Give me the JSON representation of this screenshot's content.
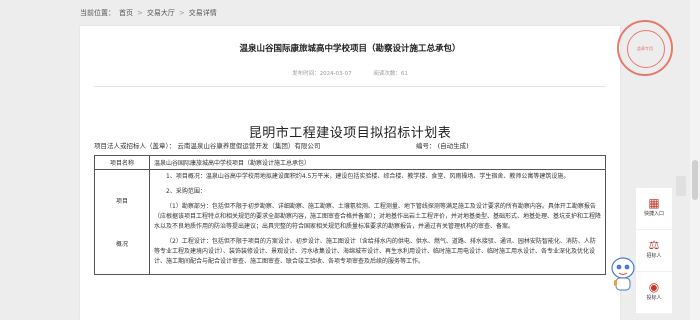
{
  "breadcrumb": {
    "current_label": "当前位置：",
    "home": "首页",
    "market": "交易大厅",
    "detail": "交易详情"
  },
  "header": {
    "title": "温泉山谷国际康旅城高中学校项目（勘察设计施工总承包）",
    "publish_label": "发布时间：2024-03-07",
    "views_label": "阅读次数：61"
  },
  "document": {
    "title": "昆明市工程建设项目拟招标计划表",
    "legal_label": "项目法人或招标人（盖章）：",
    "legal_value": "云南温泉山谷康养度假运营开发（集团）有限公司",
    "serial_label": "编号：",
    "serial_value": "(自动生成)",
    "row_name_label": "项目名称",
    "row_name_value": "温泉山谷国际康旅城高中学校项目（勘察设计施工总承包）",
    "row_overview_label1": "项目",
    "row_overview_label2": "概况",
    "p1": "1、项目概况：温泉山谷高中学校用地拟建设面积约4.5万平米，建设包括实验楼、综合楼、教学楼、食堂、风雨操场、学生宿舍、教师公寓等建筑设施。",
    "p2": "2、采购范围：",
    "p3": "（1）勘察部分：包括但不限于初步勘察、详细勘察、施工勘察、土壤氡检测、工程测量、地下管线探测等满足施工及设计要求的所有勘察内容。具体开工勘察报告（应根据该项目工程特点和相关规范的要求全部勘察内容，施工图审查合格并备案）；对地基作出岩土工程评价，并对地基类型、基础形式、地基处理、基坑支护和工程降水以及不良地质作用的防治等提出建议；出具完整的符合国家相关规范和质量标准要求的勘察报告，并通过有关管理机构的审查、备案。",
    "p4": "（2）工程设计：包括但不限于项目的方案设计、初步设计、施工图设计（含给排水内的供电、供水、燃气、道路、排水接驳、通讯、园林安防智能化、消防、人防等专业工程及建境内设计）、装饰装修设计、景观设计、污水收集设计、海绵城市设计、再生水利用设计、临时施工用电设计、临时施工用水设计、各专业深化及优化设计、施工期间配合与配合设计审查、施工图审查、联合竣工验收、各项专项审查及后续的服务等工作。"
  },
  "stamp": {
    "text": "盖章专用"
  },
  "sidebar": {
    "quick_entry": "快捷入口",
    "tender": "招标人",
    "bidder": "投标人"
  }
}
